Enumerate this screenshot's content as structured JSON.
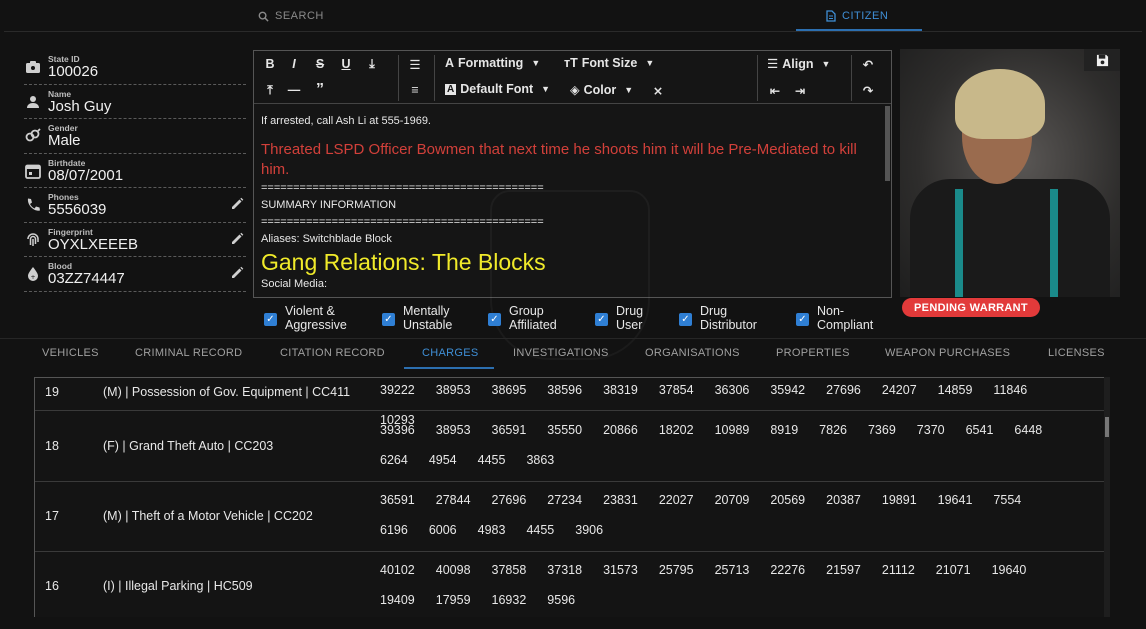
{
  "nav": {
    "search_label": "SEARCH",
    "citizen_label": "CITIZEN"
  },
  "profile": {
    "fields": [
      {
        "label": "State ID",
        "value": "100026",
        "icon": "id-badge-icon",
        "editable": false
      },
      {
        "label": "Name",
        "value": "Josh Guy",
        "icon": "person-icon",
        "editable": false
      },
      {
        "label": "Gender",
        "value": "Male",
        "icon": "gender-icon",
        "editable": false
      },
      {
        "label": "Birthdate",
        "value": "08/07/2001",
        "icon": "calendar-icon",
        "editable": false
      },
      {
        "label": "Phones",
        "value": "5556039",
        "icon": "phone-icon",
        "editable": true
      },
      {
        "label": "Fingerprint",
        "value": "OYXLXEEEB",
        "icon": "fingerprint-icon",
        "editable": true
      },
      {
        "label": "Blood",
        "value": "03ZZ74447",
        "icon": "blood-drop-icon",
        "editable": true
      }
    ]
  },
  "editor": {
    "toolbar": {
      "formatting_label": "Formatting",
      "font_size_label": "Font Size",
      "default_font_label": "Default Font",
      "color_label": "Color",
      "align_label": "Align"
    },
    "content": {
      "line1": "If arrested, call Ash Li at 555-1969.",
      "red_text": "Threated LSPD Officer Bowmen that next time he shoots him it will be Pre-Mediated to kill him.",
      "divider1": "============================================",
      "summary": "SUMMARY INFORMATION",
      "divider2": "============================================",
      "aliases": "Aliases: Switchblade Block",
      "gang": "Gang Relations: The Blocks",
      "social": "Social Media:"
    }
  },
  "status": {
    "warrant_label": "PENDING WARRANT",
    "warrant_color": "#e23a3a"
  },
  "flags": [
    {
      "line1": "Violent &",
      "line2": "Aggressive",
      "checked": true
    },
    {
      "line1": "Mentally",
      "line2": "Unstable",
      "checked": true
    },
    {
      "line1": "Group",
      "line2": "Affiliated",
      "checked": true
    },
    {
      "line1": "Drug",
      "line2": "User",
      "checked": true
    },
    {
      "line1": "Drug",
      "line2": "Distributor",
      "checked": true
    },
    {
      "line1": "Non-",
      "line2": "Compliant",
      "checked": true
    }
  ],
  "tabs": [
    {
      "label": "VEHICLES"
    },
    {
      "label": "CRIMINAL RECORD"
    },
    {
      "label": "CITATION RECORD"
    },
    {
      "label": "CHARGES",
      "active": true
    },
    {
      "label": "INVESTIGATIONS"
    },
    {
      "label": "ORGANISATIONS"
    },
    {
      "label": "PROPERTIES"
    },
    {
      "label": "WEAPON PURCHASES"
    },
    {
      "label": "LICENSES"
    }
  ],
  "charges": [
    {
      "count": "19",
      "charge": "(M) | Possession of Gov. Equipment | CC411",
      "ids": [
        "39222",
        "38953",
        "38695",
        "38596",
        "38319",
        "37854",
        "36306",
        "35942",
        "27696",
        "24207",
        "14859",
        "11846",
        "10293"
      ]
    },
    {
      "count": "18",
      "charge": "(F) | Grand Theft Auto | CC203",
      "ids": [
        "39396",
        "38953",
        "36591",
        "35550",
        "20866",
        "18202",
        "10989",
        "8919",
        "7826",
        "7369",
        "7370",
        "6541",
        "6448",
        "6264",
        "4954",
        "4455",
        "3863"
      ]
    },
    {
      "count": "17",
      "charge": "(M) | Theft of a Motor Vehicle | CC202",
      "ids": [
        "36591",
        "27844",
        "27696",
        "27234",
        "23831",
        "22027",
        "20709",
        "20569",
        "20387",
        "19891",
        "19641",
        "7554",
        "6196",
        "6006",
        "4983",
        "4455",
        "3906"
      ]
    },
    {
      "count": "16",
      "charge": "(I) | Illegal Parking | HC509",
      "ids": [
        "40102",
        "40098",
        "37858",
        "37318",
        "31573",
        "25795",
        "25713",
        "22276",
        "21597",
        "21112",
        "21071",
        "19640",
        "19409",
        "17959",
        "16932",
        "9596"
      ]
    }
  ],
  "colors": {
    "accent": "#2f7fd4",
    "red_note": "#d2403a",
    "yellow_note": "#f0ea2a"
  }
}
